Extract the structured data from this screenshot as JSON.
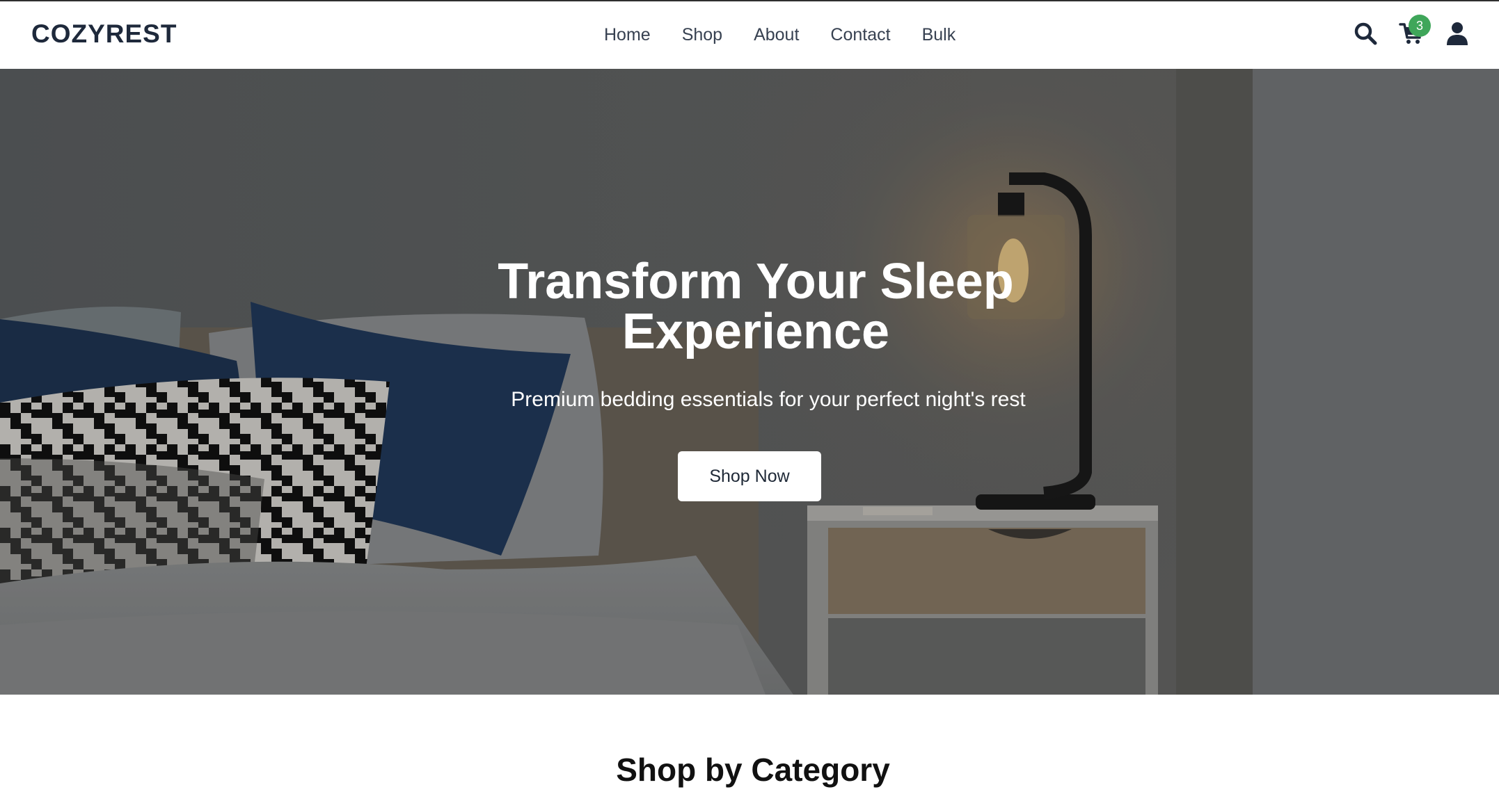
{
  "brand": {
    "logo_text": "COZYREST"
  },
  "nav": {
    "items": [
      {
        "label": "Home"
      },
      {
        "label": "Shop"
      },
      {
        "label": "About"
      },
      {
        "label": "Contact"
      },
      {
        "label": "Bulk"
      }
    ]
  },
  "header_icons": {
    "search": "search-icon",
    "cart": "cart-icon",
    "account": "user-icon",
    "cart_count": "3"
  },
  "hero": {
    "title_line1": "Transform Your Sleep",
    "title_line2": "Experience",
    "subtitle": "Premium bedding essentials for your perfect night's rest",
    "cta_label": "Shop Now"
  },
  "categories": {
    "heading": "Shop by Category"
  },
  "colors": {
    "badge": "#3fa65a",
    "text_dark": "#1e293b",
    "hero_text": "#ffffff"
  }
}
